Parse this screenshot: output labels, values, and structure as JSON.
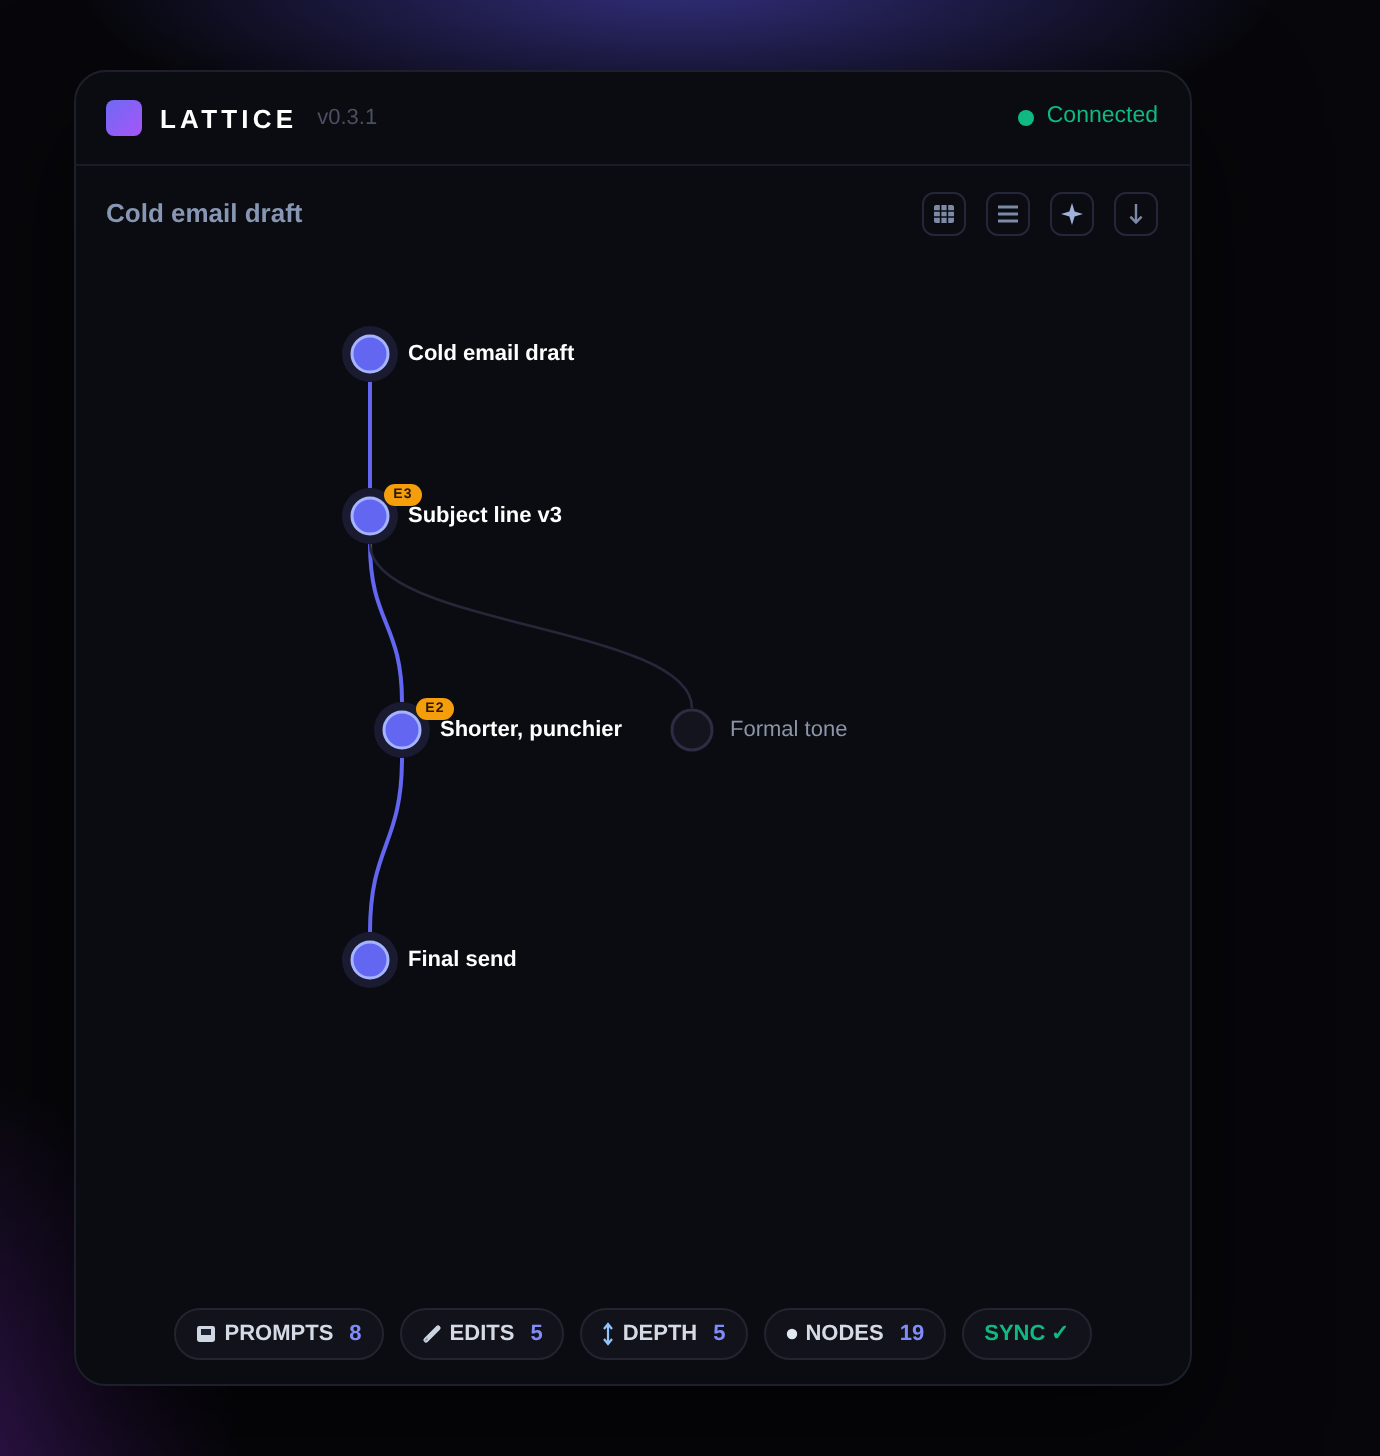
{
  "app": {
    "name": "LATTICE",
    "version": "v0.3.1",
    "status": {
      "label": "Connected",
      "connected": true
    }
  },
  "toolbar": {
    "title": "Cold email draft",
    "buttons": [
      {
        "kind": "table"
      },
      {
        "kind": "list"
      },
      {
        "kind": "sparkle"
      },
      {
        "kind": "arrow"
      }
    ]
  },
  "graph": {
    "nodes": [
      {
        "label": "Cold email draft",
        "active": true,
        "children": [
          {
            "label": "Subject line v3",
            "active": true,
            "badge": "E3",
            "children": [
              {
                "label": "Shorter, punchier",
                "active": true,
                "badge": "E2",
                "children": [
                  {
                    "label": "Final send",
                    "active": true
                  }
                ]
              },
              {
                "label": "Formal tone",
                "active": false
              }
            ]
          }
        ]
      }
    ]
  },
  "stats": [
    {
      "kind": "prompts",
      "label": "PROMPTS",
      "value": "8"
    },
    {
      "kind": "edits",
      "label": "EDITS",
      "value": "5"
    },
    {
      "kind": "depth",
      "label": "DEPTH",
      "value": "5"
    },
    {
      "kind": "nodes",
      "label": "NODES",
      "value": "19"
    },
    {
      "kind": "sync",
      "label": "SYNC ✓"
    }
  ]
}
